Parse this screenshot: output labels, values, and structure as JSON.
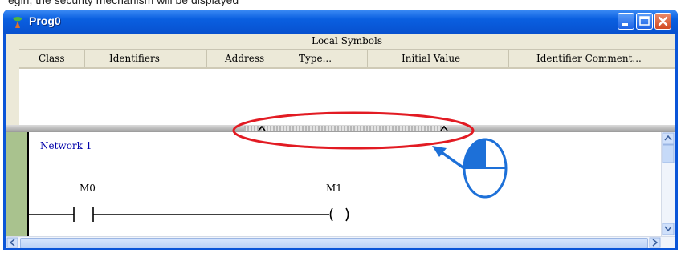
{
  "caption": "egin, the security mechanism will be displayed",
  "window": {
    "title": "Prog0",
    "icon": "program-icon",
    "buttons": [
      {
        "name": "minimize-button",
        "icon": "minimize-icon"
      },
      {
        "name": "maximize-button",
        "icon": "maximize-icon"
      },
      {
        "name": "close-button",
        "icon": "close-icon"
      }
    ]
  },
  "symbols": {
    "header": "Local Symbols",
    "columns": [
      "Class",
      "Identifiers",
      "Address",
      "Type...",
      "Initial Value",
      "Identifier Comment..."
    ]
  },
  "ladder": {
    "network_label": "Network 1",
    "contact_label": "M0",
    "coil_label": "M1"
  },
  "colors": {
    "titlebar": "#0a5fe0",
    "rung_bar": "#a9c28e",
    "annotation": "#e21b23",
    "pointer": "#1d70d8"
  },
  "annotation": {
    "type": "highlight-ellipse",
    "pointer_icon": "mouse-click-icon"
  }
}
